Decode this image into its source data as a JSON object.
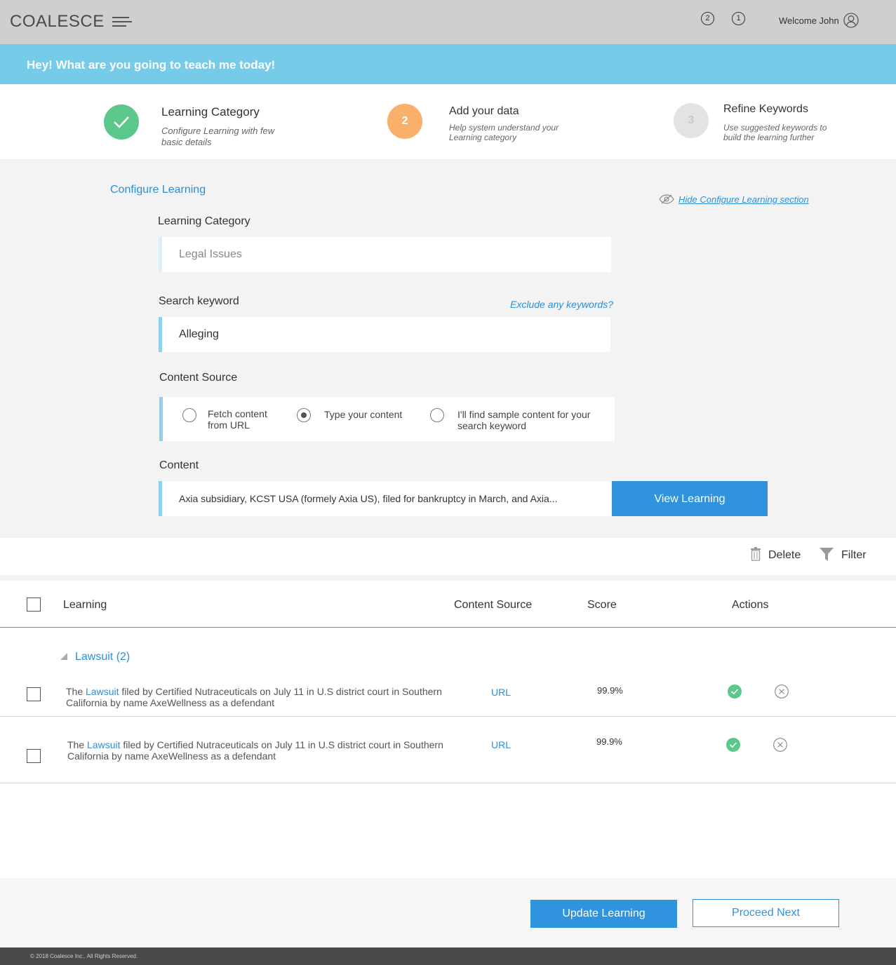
{
  "header": {
    "logo": "COALESCE",
    "notifications": [
      "2",
      "1"
    ],
    "welcome": "Welcome John"
  },
  "banner": {
    "text": "Hey! What are you going to teach me today!"
  },
  "steps": [
    {
      "number": "",
      "title": "Learning Category",
      "desc_line1": "Configure Learning with few",
      "desc_line2": "basic details",
      "status": "done"
    },
    {
      "number": "2",
      "title": "Add your data",
      "desc_line1": "Help system understand your",
      "desc_line2": "Learning category",
      "status": "active"
    },
    {
      "number": "3",
      "title": "Refine Keywords",
      "desc_line1": "Use suggested keywords to",
      "desc_line2": "build the learning further",
      "status": "pending"
    }
  ],
  "config": {
    "title": "Configure Learning",
    "hide_link": "Hide Configure Learning section",
    "category_label": "Learning Category",
    "category_placeholder": "Legal Issues",
    "keyword_label": "Search keyword",
    "exclude_link": "Exclude any keywords?",
    "keyword_value": "Alleging",
    "source_label": "Content Source",
    "source_options": [
      {
        "line1": "Fetch content",
        "line2": "from URL",
        "checked": false
      },
      {
        "line1": "Type your content",
        "line2": "",
        "checked": true
      },
      {
        "line1": "I'll find sample content for your",
        "line2": "search keyword",
        "checked": false
      }
    ],
    "content_label": "Content",
    "content_value": "Axia subsidiary, KCST USA (formely Axia US), filed for bankruptcy in March, and Axia...",
    "view_button": "View Learning"
  },
  "toolbar": {
    "delete": "Delete",
    "filter": "Filter"
  },
  "table": {
    "headers": {
      "learning": "Learning",
      "source": "Content Source",
      "score": "Score",
      "actions": "Actions"
    },
    "group": "Lawsuit (2)",
    "rows": [
      {
        "pre": "The ",
        "link": "Lawsuit",
        "post_line1": " filed by Certified Nutraceuticals on July 11 in U.S district court in Southern",
        "line2": "California by name AxeWellness as a defendant",
        "source": "URL",
        "score": "99.9%"
      },
      {
        "pre": "The ",
        "link": "Lawsuit",
        "post_line1": " filed by Certified Nutraceuticals on July 11 in U.S district court in Southern",
        "line2": "California by name AxeWellness as a defendant",
        "source": "URL",
        "score": "99.9%"
      }
    ]
  },
  "footer": {
    "update_button": "Update Learning",
    "proceed_button": "Proceed Next",
    "copyright": "© 2018 Coalesce Inc.. All Rights Reserved."
  },
  "colors": {
    "banner": "#75cbe8",
    "accent_blue": "#2f93dd",
    "step_done": "#5cc78b",
    "step_active": "#f8b06b",
    "step_pending": "#e3e3e3",
    "progress": "#e9b735"
  }
}
